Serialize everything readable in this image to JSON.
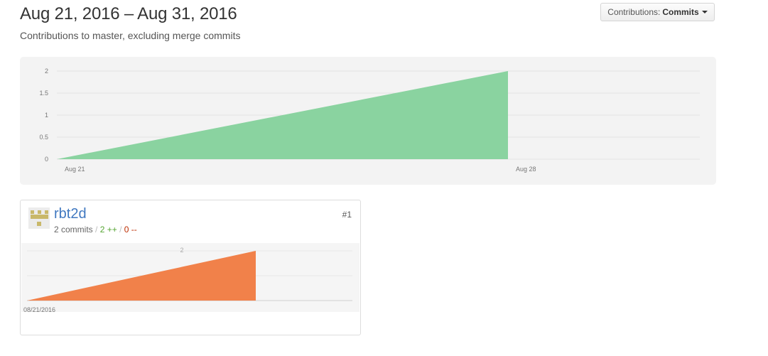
{
  "header": {
    "title": "Aug 21, 2016 – Aug 31, 2016",
    "subtitle": "Contributions to master, excluding merge commits"
  },
  "contributions_button": {
    "prefix": "Contributions:",
    "value": "Commits"
  },
  "chart_data": [
    {
      "type": "area",
      "x": [
        "Aug 21",
        "Aug 28"
      ],
      "values": [
        0,
        2
      ],
      "xticks": [
        "Aug 21",
        "Aug 28"
      ],
      "yticks": [
        "0",
        "0.5",
        "1",
        "1.5",
        "2"
      ],
      "ylim": [
        0,
        2
      ],
      "color": "#8ad3a0"
    },
    {
      "type": "area",
      "x": [
        "08/21/2016",
        ""
      ],
      "values": [
        0,
        2
      ],
      "xticks": [
        "08/21/2016"
      ],
      "yticks": [
        "2"
      ],
      "ylim": [
        0,
        2
      ],
      "color": "#f1814a"
    }
  ],
  "contributor": {
    "name": "rbt2d",
    "rank": "#1",
    "commits": "2 commits",
    "additions": "2 ++",
    "deletions": "0 --",
    "separator": "/"
  }
}
